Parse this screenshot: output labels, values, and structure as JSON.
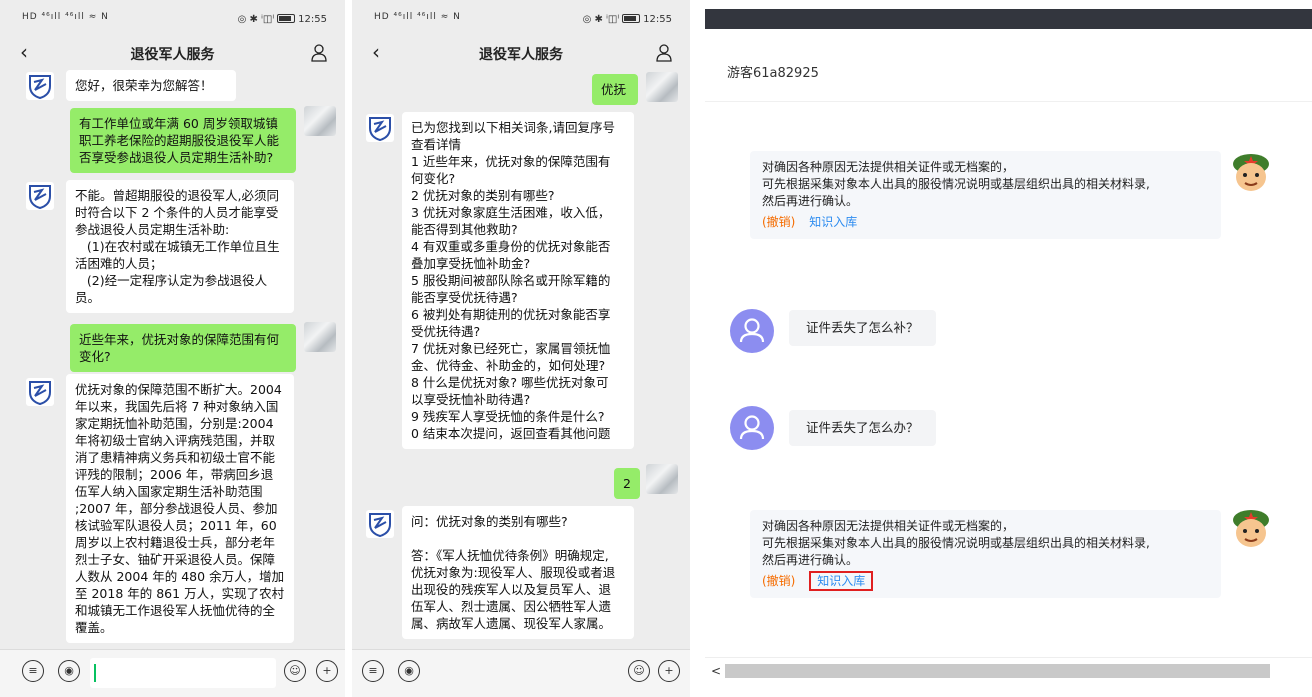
{
  "status": {
    "left": "HD ⁴⁶ıll ⁴⁶ıll ≈ N",
    "right": "◎ ✱ ⁱ◫ˡ",
    "time": "12:55"
  },
  "phone1": {
    "title": "退役军人服务",
    "messages": [
      {
        "from": "bot",
        "text": "您好，很荣幸为您解答！"
      },
      {
        "from": "me",
        "text": "有工作单位或年满 60 周岁领取城镇\n职工养老保险的超期服役退役军人能\n否享受参战退役人员定期生活补助?"
      },
      {
        "from": "bot",
        "text": "不能。曾超期服役的退役军人,必须同\n时符合以下 2 个条件的人员才能享受\n参战退役人员定期生活补助:\n   (1)在农村或在城镇无工作单位且生\n活困难的人员；\n   (2)经一定程序认定为参战退役人\n员。"
      },
      {
        "from": "me",
        "text": "近些年来，优抚对象的保障范围有何\n变化?"
      },
      {
        "from": "bot",
        "text": "优抚对象的保障范围不断扩大。2004\n年以来，我国先后将 7 种对象纳入国\n家定期抚恤补助范围，分别是:2004\n年将初级士官纳入评病残范围，并取\n消了患精神病义务兵和初级士官不能\n评残的限制；2006 年，带病回乡退\n伍军人纳入国家定期生活补助范围\n;2007 年，部分参战退役人员、参加\n核试验军队退役人员；2011 年，60\n周岁以上农村籍退役士兵，部分老年\n烈士子女、铀矿开采退役人员。保障\n人数从 2004 年的 480 余万人，增加\n至 2018 年的 861 万人，实现了农村\n和城镇无工作退役军人抚恤优待的全\n覆盖。"
      }
    ]
  },
  "phone2": {
    "title": "退役军人服务",
    "messages": [
      {
        "from": "me",
        "text": "优抚"
      },
      {
        "from": "bot",
        "text": "已为您找到以下相关词条,请回复序号\n查看详情\n1 近些年来，优抚对象的保障范围有\n何变化?\n2 优抚对象的类别有哪些?\n3 优抚对象家庭生活困难，收入低，\n能否得到其他救助?\n4 有双重或多重身份的优抚对象能否\n叠加享受抚恤补助金?\n5 服役期间被部队除名或开除军籍的\n能否享受优抚待遇?\n6 被判处有期徒刑的优抚对象能否享\n受优抚待遇?\n7 优抚对象已经死亡，家属冒领抚恤\n金、优待金、补助金的，如何处理?\n8 什么是优抚对象? 哪些优抚对象可\n以享受抚恤补助待遇?\n9 残疾军人享受抚恤的条件是什么?\n0 结束本次提问，返回查看其他问题"
      },
      {
        "from": "me",
        "text": "2"
      },
      {
        "from": "bot",
        "text": "问：优抚对象的类别有哪些?\n\n答：《军人抚恤优待条例》明确规定,\n优抚对象为:现役军人、服现役或者退\n出现役的残疾军人以及复员军人、退\n伍军人、烈士遗属、因公牺牲军人遗\n属、病故军人遗属、现役军人家属。"
      }
    ]
  },
  "web": {
    "visitor": "游客61a82925",
    "answer_lines": [
      "对确因各种原因无法提供相关证件或无档案的，",
      "可先根据采集对象本人出具的服役情况说明或基层组织出具的相关材料录,",
      "然后再进行确认。"
    ],
    "revoke_label": "(撤销)",
    "kb_label": "知识入库",
    "q1": "证件丢失了怎么补？",
    "q2": "证件丢失了怎么办？",
    "scroll_left": "<"
  }
}
